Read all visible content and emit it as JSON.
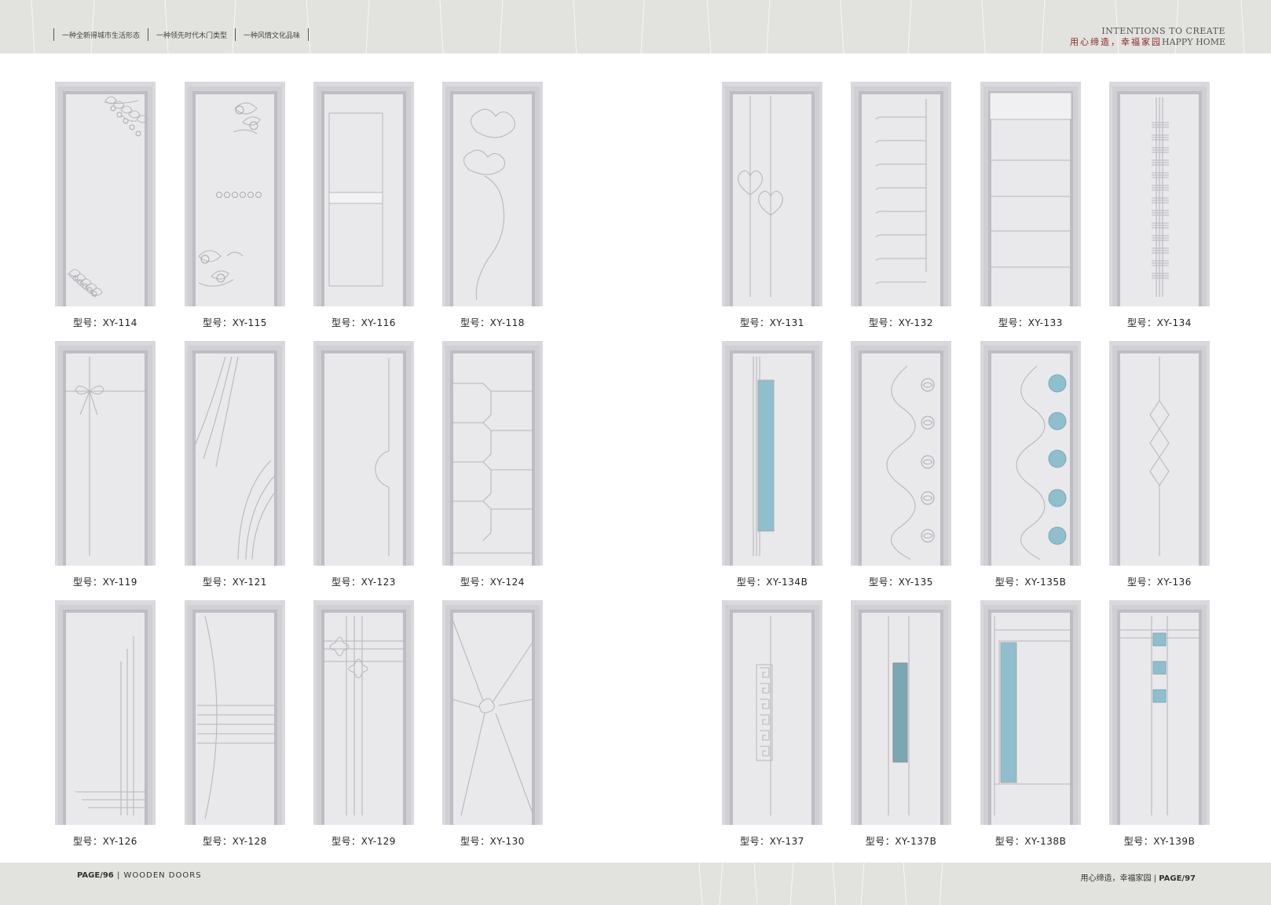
{
  "header": {
    "slogans": [
      "一种全新得城市生活形态",
      "一种领先时代木门类型",
      "一种风情文化品味"
    ],
    "brand_en_1": "INTENTIONS TO CREATE",
    "brand_cn": "用心缔造，幸福家园",
    "brand_en_2": "HAPPY HOME"
  },
  "footer": {
    "left_page": "PAGE/96",
    "left_label": "WOODEN DOORS",
    "right_label": "用心缔造，幸福家园",
    "right_page": "PAGE/97"
  },
  "caption_prefix": "型号：",
  "colors": {
    "band": "#e2e2df",
    "door": "#e9e9ec",
    "glass": "#8fbfcc",
    "title_red": "#8b2a2a"
  },
  "doors": [
    {
      "model": "XY-114",
      "pattern": "flower-corners"
    },
    {
      "model": "XY-115",
      "pattern": "scrolls-dots"
    },
    {
      "model": "XY-116",
      "pattern": "panel-rail"
    },
    {
      "model": "XY-118",
      "pattern": "tulip-stem"
    },
    {
      "model": "XY-131",
      "pattern": "hearts"
    },
    {
      "model": "XY-132",
      "pattern": "ladder-grooves"
    },
    {
      "model": "XY-133",
      "pattern": "horizontal-panels"
    },
    {
      "model": "XY-134",
      "pattern": "center-stripes"
    },
    {
      "model": "XY-119",
      "pattern": "bow"
    },
    {
      "model": "XY-121",
      "pattern": "arcs"
    },
    {
      "model": "XY-123",
      "pattern": "half-circle"
    },
    {
      "model": "XY-124",
      "pattern": "octagon-rows"
    },
    {
      "model": "XY-134B",
      "pattern": "vertical-glass"
    },
    {
      "model": "XY-135",
      "pattern": "wave-roses"
    },
    {
      "model": "XY-135B",
      "pattern": "wave-glass-circles"
    },
    {
      "model": "XY-136",
      "pattern": "diamonds"
    },
    {
      "model": "XY-126",
      "pattern": "corner-lines"
    },
    {
      "model": "XY-128",
      "pattern": "curve-bars"
    },
    {
      "model": "XY-129",
      "pattern": "stars-grid"
    },
    {
      "model": "XY-130",
      "pattern": "starburst"
    },
    {
      "model": "XY-137",
      "pattern": "greek-key"
    },
    {
      "model": "XY-137B",
      "pattern": "narrow-glass"
    },
    {
      "model": "XY-138B",
      "pattern": "side-glass"
    },
    {
      "model": "XY-139B",
      "pattern": "glass-squares"
    }
  ]
}
